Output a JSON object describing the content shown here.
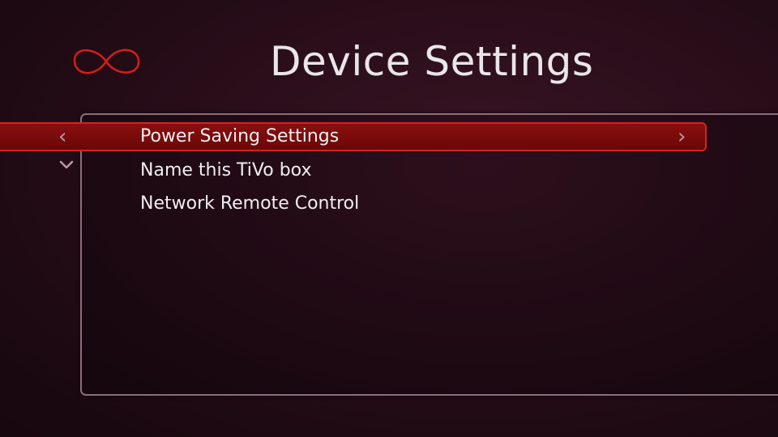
{
  "header": {
    "title": "Device Settings",
    "logo_icon": "infinity-logo-icon"
  },
  "menu": {
    "items": [
      {
        "label": "Power Saving Settings",
        "selected": true
      },
      {
        "label": "Name this TiVo box",
        "selected": false
      },
      {
        "label": "Network Remote Control",
        "selected": false
      }
    ]
  },
  "icons": {
    "left_arrow": "‹",
    "right_arrow": "›",
    "down_arrow": "chevron-down-icon"
  },
  "colors": {
    "highlight_fill": "#7a0b0b",
    "highlight_border": "#d5231b",
    "logo": "#d21f1a",
    "text": "#f1eef0"
  }
}
